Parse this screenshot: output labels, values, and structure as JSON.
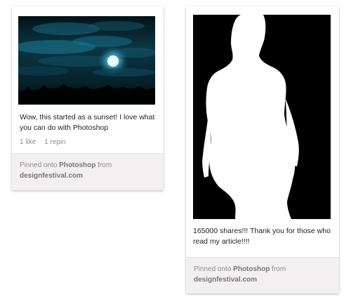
{
  "pins": [
    {
      "image_alt": "Blue-toned night sky with clouds and a moon",
      "description": "Wow, this started as a sunset! I love what you can do with Photoshop",
      "stats": {
        "likes": "1 like",
        "repins": "1 repin"
      },
      "footer": {
        "prefix": "Pinned onto",
        "board": "Photoshop",
        "from": "from",
        "source": "designfestival.com"
      }
    },
    {
      "image_alt": "White silhouette of a woman on black background",
      "description": "165000 shares!!! Thank you for those who read my article!!!!",
      "footer": {
        "prefix": "Pinned onto",
        "board": "Photoshop",
        "from": "from",
        "source": "designfestival.com"
      }
    }
  ],
  "colors": {
    "card_bg": "#ffffff",
    "footer_bg": "#f2f0f0",
    "muted_text": "#8f8f8f"
  }
}
